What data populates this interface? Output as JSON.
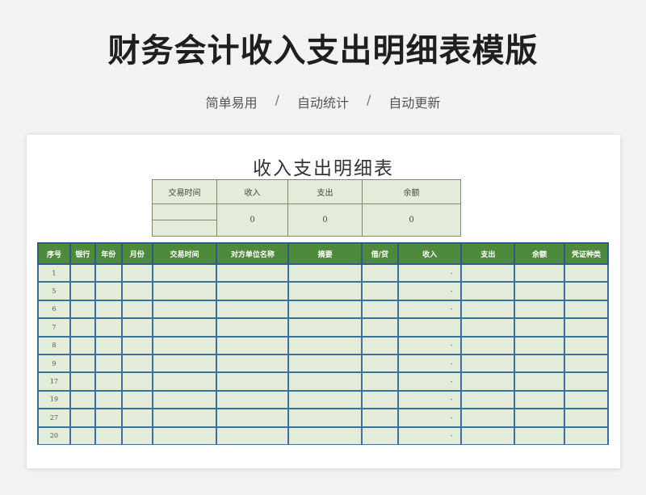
{
  "header": {
    "title": "财务会计收入支出明细表模版",
    "tags": [
      "简单易用",
      "自动统计",
      "自动更新"
    ],
    "separator": "/"
  },
  "sheet": {
    "title": "收入支出明细表",
    "summary": {
      "headers": [
        "交易时间",
        "收入",
        "支出",
        "余额"
      ],
      "values": [
        "0",
        "0",
        "0"
      ]
    },
    "ledger": {
      "columns": [
        "序号",
        "银行",
        "年份",
        "月份",
        "交易时间",
        "对方单位名称",
        "摘要",
        "借/贷",
        "收入",
        "支出",
        "余额",
        "凭证种类"
      ],
      "rows": [
        {
          "no": "1",
          "income": "-"
        },
        {
          "no": "5",
          "income": "-"
        },
        {
          "no": "6",
          "income": "-"
        },
        {
          "no": "7",
          "income": ""
        },
        {
          "no": "8",
          "income": "-"
        },
        {
          "no": "9",
          "income": "-"
        },
        {
          "no": "17",
          "income": "-"
        },
        {
          "no": "19",
          "income": "-"
        },
        {
          "no": "27",
          "income": "-"
        },
        {
          "no": "20",
          "income": "-"
        }
      ]
    }
  },
  "colors": {
    "header_green": "#4d8a3c",
    "cell_green": "#e3ecd8",
    "grid_blue": "#3a6fa0"
  }
}
